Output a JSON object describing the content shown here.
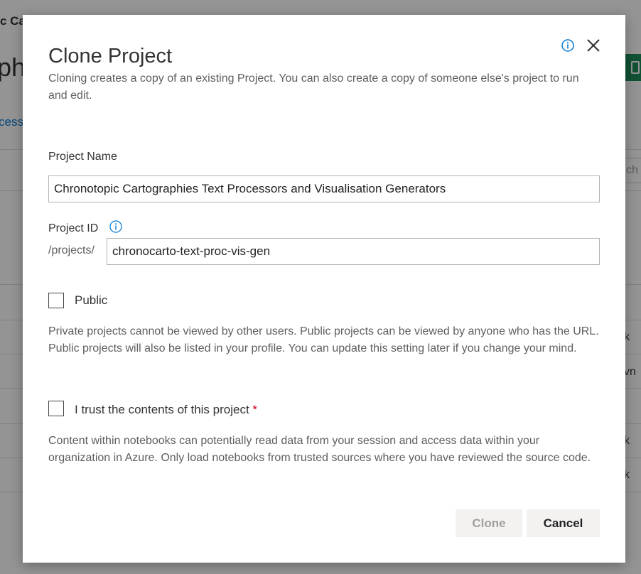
{
  "background": {
    "topbar_fragment": "c Ca",
    "heading_fragment": "phi",
    "link_fragment": "cess",
    "search_fragment": "ch",
    "row_fragments": [
      "k",
      "vn",
      "k",
      "k"
    ]
  },
  "dialog": {
    "title": "Clone Project",
    "description": "Cloning creates a copy of an existing Project. You can also create a copy of someone else's project to run and edit.",
    "project_name": {
      "label": "Project Name",
      "value": "Chronotopic Cartographies Text Processors and Visualisation Generators"
    },
    "project_id": {
      "label": "Project ID",
      "prefix": "/projects/",
      "value": "chronocarto-text-proc-vis-gen"
    },
    "public": {
      "label": "Public",
      "checked": false,
      "help": "Private projects cannot be viewed by other users. Public projects can be viewed by anyone who has the URL. Public projects will also be listed in your profile. You can update this setting later if you change your mind."
    },
    "trust": {
      "label": "I trust the contents of this project",
      "required_marker": "*",
      "checked": false,
      "help": "Content within notebooks can potentially read data from your session and access data within your organization in Azure. Only load notebooks from trusted sources where you have reviewed the source code."
    },
    "buttons": {
      "clone_label": "Clone",
      "cancel_label": "Cancel"
    }
  },
  "colors": {
    "accent": "#0078d4",
    "required": "#d0021b",
    "overlay": "rgba(0,0,0,0.42)"
  },
  "icons": {
    "info": "info-icon",
    "close": "close-icon"
  }
}
